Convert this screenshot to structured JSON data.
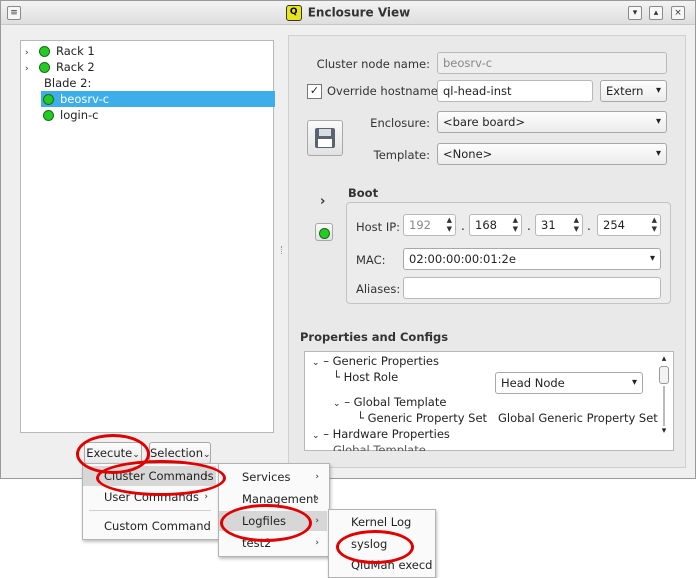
{
  "window": {
    "title": "Enclosure View",
    "logo_letter": "Q",
    "menu_btn": "≡",
    "minimize_btn": "▾",
    "maximize_btn": "▴",
    "close_btn": "×"
  },
  "tree": {
    "items": [
      {
        "label": "Rack 1",
        "has_arrow": true,
        "status": "green"
      },
      {
        "label": "Rack 2",
        "has_arrow": true,
        "status": "green"
      },
      {
        "label": "Blade 2:",
        "has_arrow": false,
        "status": null
      },
      {
        "label": "beosrv-c",
        "has_arrow": false,
        "status": "green",
        "selected": true
      },
      {
        "label": "login-c",
        "has_arrow": false,
        "status": "green"
      }
    ],
    "arrow_glyph": "›"
  },
  "buttons": {
    "execute": "Execute",
    "selection": "Selection",
    "dropdown_glyph": "⌄"
  },
  "form": {
    "cluster_node_name_label": "Cluster node name:",
    "cluster_node_name_value": "beosrv-c",
    "override_hostname_label": "Override hostname:",
    "override_checked_glyph": "✓",
    "override_hostname_value": "ql-head-inst",
    "extern_value": "Extern",
    "enclosure_label": "Enclosure:",
    "enclosure_value": "<bare board>",
    "template_label": "Template:",
    "template_value": "<None>",
    "boot_label": "Boot",
    "boot_arrow": "›",
    "host_ip_label": "Host IP:",
    "ip": [
      "192",
      "168",
      "31",
      "254"
    ],
    "dot": ".",
    "mac_label": "MAC:",
    "mac_value": "02:00:00:00:01:2e",
    "aliases_label": "Aliases:",
    "aliases_value": "",
    "combo_caret": "▾"
  },
  "props": {
    "heading": "Properties and Configs",
    "rows": [
      {
        "label": "Generic Properties"
      },
      {
        "label": "Host Role"
      },
      {
        "label": "Head Node"
      },
      {
        "label": "Global Template"
      },
      {
        "label": "Generic Property Set"
      },
      {
        "label": "Global Generic Property Set"
      },
      {
        "label": "Hardware Properties"
      },
      {
        "label": "Global Template"
      }
    ],
    "expand_glyph": "⌄"
  },
  "menus": {
    "execute_menu": [
      "Cluster Commands",
      "User Commands",
      "Custom Command"
    ],
    "cluster_commands_menu": [
      "Services",
      "Management",
      "Logfiles",
      "test2"
    ],
    "logfiles_menu": [
      "Kernel Log",
      "syslog",
      "QluMan execd"
    ],
    "submenu_glyph": "›"
  },
  "colors": {
    "selection": "#3daee9",
    "status_green": "#22cc22",
    "annotation_red": "#e00000"
  }
}
